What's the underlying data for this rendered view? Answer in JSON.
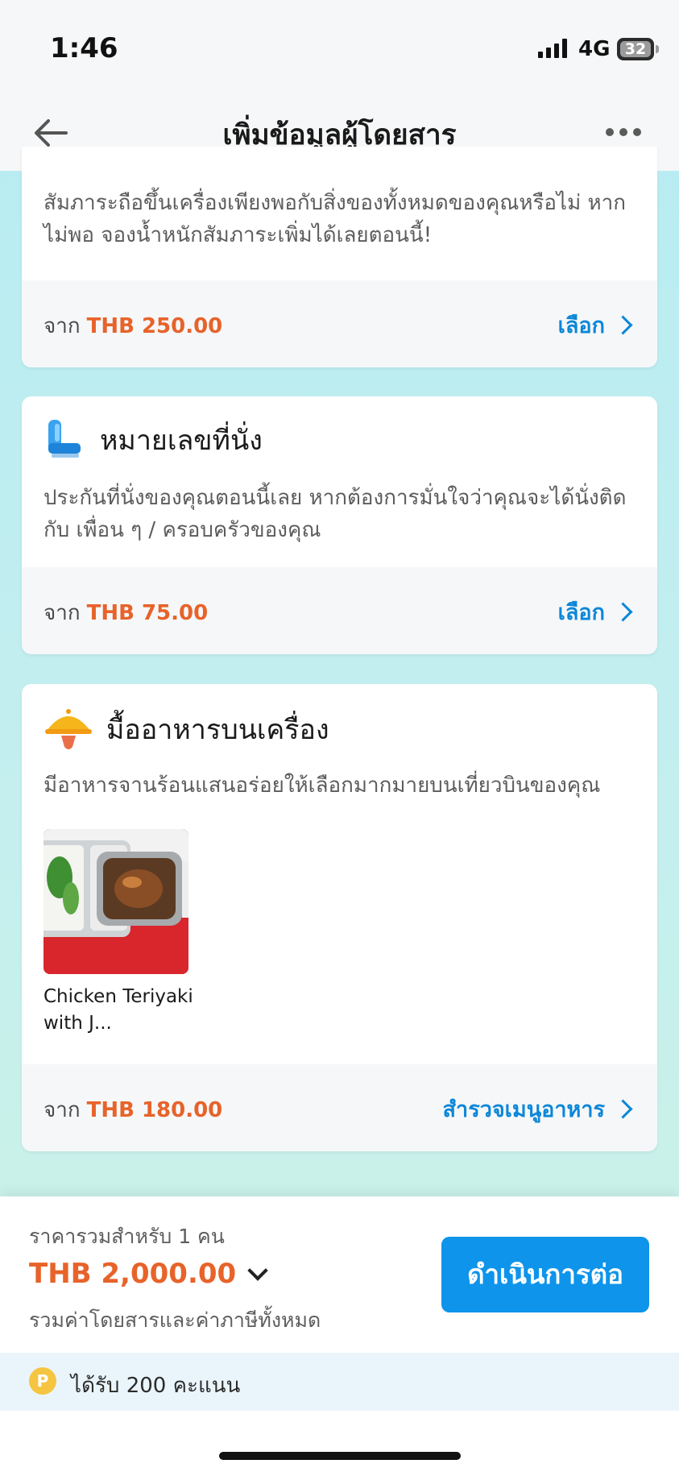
{
  "status_bar": {
    "time": "1:46",
    "network": "4G",
    "battery": "32"
  },
  "nav": {
    "title": "เพิ่มข้อมูลผู้โดยสาร"
  },
  "baggage_card": {
    "description": "สัมภาระถือขึ้นเครื่องเพียงพอกับสิ่งของทั้งหมดของคุณหรือไม่ หาก ไม่พอ จองน้ำหนักสัมภาระเพิ่มได้เลยตอนนี้!",
    "price_prefix": "จาก",
    "price": "THB 250.00",
    "action": "เลือก"
  },
  "seat_card": {
    "title": "หมายเลขที่นั่ง",
    "icon": "seat-icon",
    "description": "ประกันที่นั่งของคุณตอนนี้เลย หากต้องการมั่นใจว่าคุณจะได้นั่งติดกับ เพื่อน ๆ / ครอบครัวของคุณ",
    "price_prefix": "จาก",
    "price": "THB 75.00",
    "action": "เลือก"
  },
  "meal_card": {
    "title": "มื้ออาหารบนเครื่อง",
    "icon": "meal-cloche-icon",
    "description": "มีอาหารจานร้อนแสนอร่อยให้เลือกมากมายบนเที่ยวบินของคุณ",
    "item_name": "Chicken Teriyaki with J...",
    "price_prefix": "จาก",
    "price": "THB 180.00",
    "action": "สำรวจเมนูอาหาร"
  },
  "bottom": {
    "label": "ราคารวมสำหรับ 1 คน",
    "total": "THB 2,000.00",
    "note": "รวมค่าโดยสารและค่าภาษีทั้งหมด",
    "continue": "ดำเนินการต่อ"
  },
  "points": {
    "text": "ได้รับ 200 คะแนน"
  },
  "colors": {
    "accent": "#0e94ea",
    "price": "#e7632a",
    "link": "#0b87d8"
  }
}
